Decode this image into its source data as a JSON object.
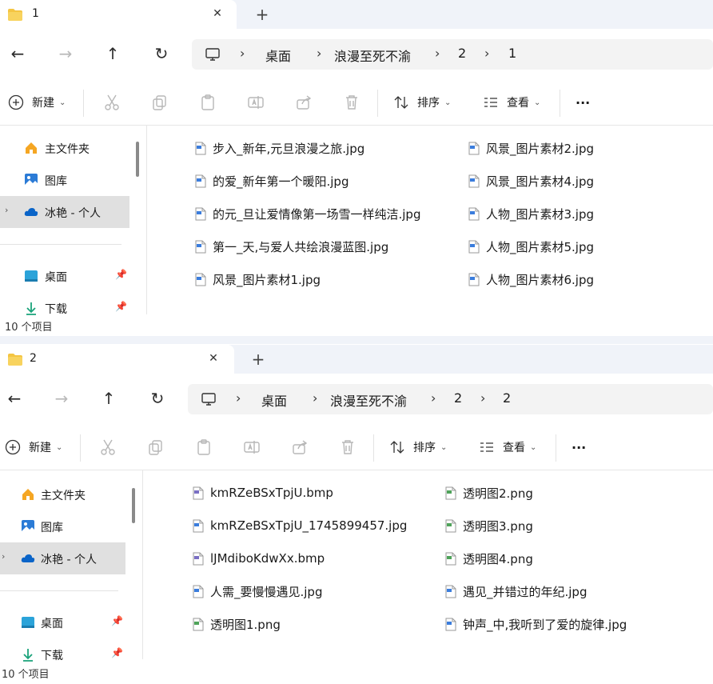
{
  "window1": {
    "tab_title": "1",
    "breadcrumb": [
      "桌面",
      "浪漫至死不渝",
      "2",
      "1"
    ],
    "toolbar": {
      "new": "新建",
      "sort": "排序",
      "view": "查看",
      "more": "···"
    },
    "sidebar": [
      {
        "label": "主文件夹",
        "icon": "home-icon"
      },
      {
        "label": "图库",
        "icon": "gallery-icon"
      },
      {
        "label": "冰艳 - 个人",
        "icon": "onedrive-icon"
      },
      {
        "label": "桌面",
        "icon": "desktop-icon"
      },
      {
        "label": "下载",
        "icon": "download-icon"
      }
    ],
    "files_col1": [
      "步入_新年,元旦浪漫之旅.jpg",
      "的爱_新年第一个暖阳.jpg",
      "的元_旦让爱情像第一场雪一样纯洁.jpg",
      "第一_天,与爱人共绘浪漫蓝图.jpg",
      "风景_图片素材1.jpg"
    ],
    "files_col2": [
      "风景_图片素材2.jpg",
      "风景_图片素材4.jpg",
      "人物_图片素材3.jpg",
      "人物_图片素材5.jpg",
      "人物_图片素材6.jpg"
    ],
    "status": "10 个项目"
  },
  "window2": {
    "tab_title": "2",
    "breadcrumb": [
      "桌面",
      "浪漫至死不渝",
      "2",
      "2"
    ],
    "toolbar": {
      "new": "新建",
      "sort": "排序",
      "view": "查看",
      "more": "···"
    },
    "sidebar": [
      {
        "label": "主文件夹",
        "icon": "home-icon"
      },
      {
        "label": "图库",
        "icon": "gallery-icon"
      },
      {
        "label": "冰艳 - 个人",
        "icon": "onedrive-icon"
      },
      {
        "label": "桌面",
        "icon": "desktop-icon"
      },
      {
        "label": "下载",
        "icon": "download-icon"
      }
    ],
    "files_col1": [
      "kmRZeBSxTpjU.bmp",
      "kmRZeBSxTpjU_1745899457.jpg",
      "lJMdiboKdwXx.bmp",
      "人需_要慢慢遇见.jpg",
      "透明图1.png"
    ],
    "files_col2": [
      "透明图2.png",
      "透明图3.png",
      "透明图4.png",
      "遇见_并错过的年纪.jpg",
      "钟声_中,我听到了爱的旋律.jpg"
    ],
    "status": "10 个项目"
  },
  "colors": {
    "accent": "#0067c0",
    "folder": "#f4c542",
    "selection": "#e0e0e0",
    "tabbar": "#f0f3f9"
  }
}
